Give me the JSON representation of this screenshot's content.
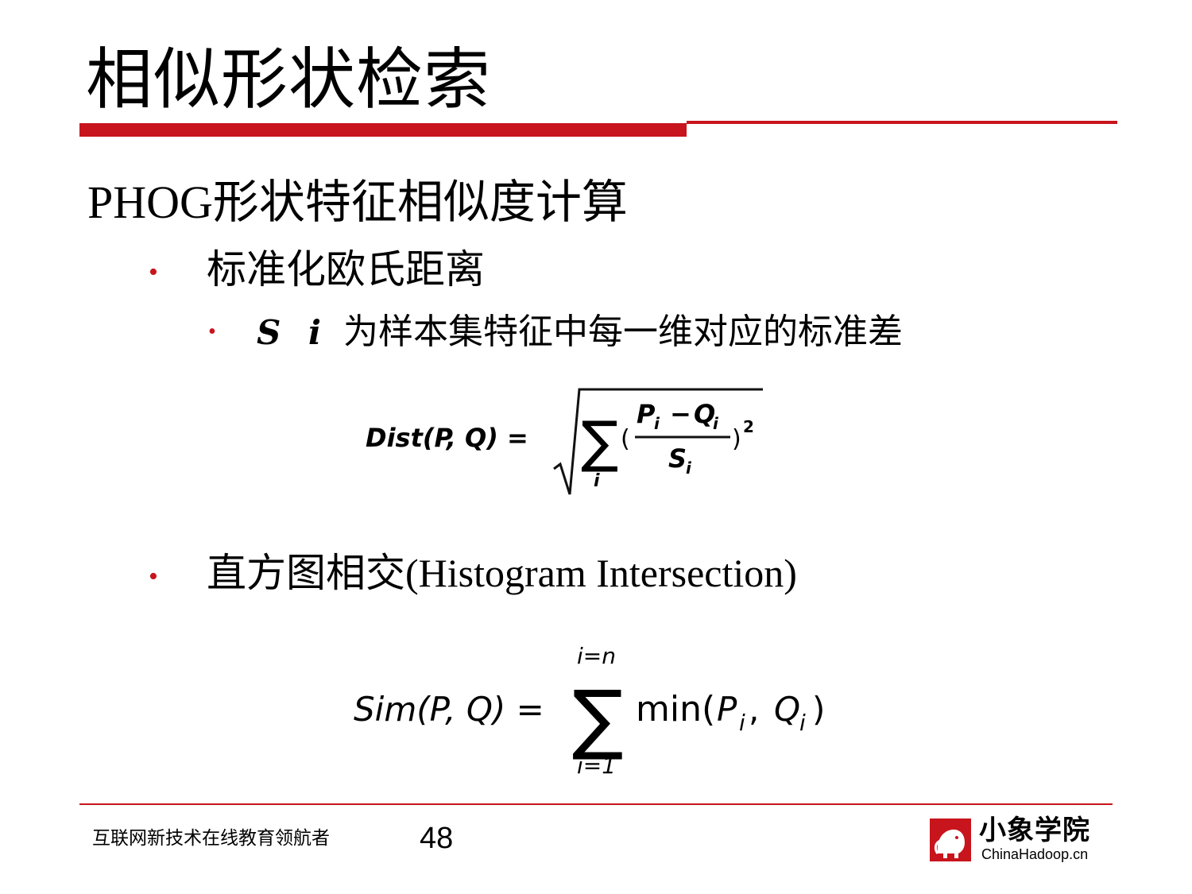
{
  "slide": {
    "title": "相似形状检索",
    "heading": "PHOG形状特征相似度计算",
    "bullets": {
      "euclid": "标准化欧氏距离",
      "sub_symbol": "S i",
      "sub_text": "为样本集特征中每一维对应的标准差",
      "hist": "直方图相交(Histogram Intersection)"
    },
    "bullet_glyph": "•"
  },
  "formula1": {
    "lhs": "Dist(P, Q) =",
    "sum_index": "i",
    "numerator_p": "P",
    "numerator_p_sub": "i",
    "minus": "−",
    "numerator_q": "Q",
    "numerator_q_sub": "i",
    "denominator": "S",
    "denominator_sub": "i",
    "open_paren": "(",
    "close_paren": ")",
    "exponent": "2"
  },
  "formula2": {
    "lhs": "Sim(P, Q) =",
    "upper": "i=n",
    "lower": "i=1",
    "func": "min(",
    "arg_p": "P",
    "arg_p_sub": "i",
    "comma": " ,",
    "arg_q": "Q",
    "arg_q_sub": "i",
    "close": ")"
  },
  "footer": {
    "tagline": "互联网新技术在线教育领航者",
    "page_number": "48",
    "logo_name": "小象学院",
    "logo_domain": "ChinaHadoop.cn"
  },
  "colors": {
    "accent": "#c8141c"
  }
}
